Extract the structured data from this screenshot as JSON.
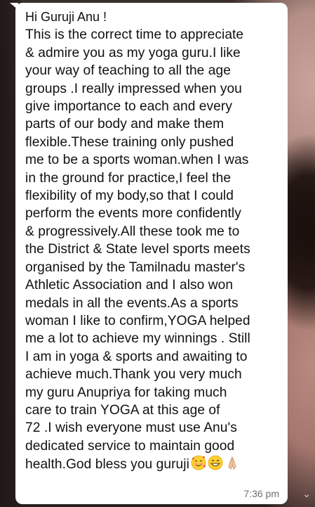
{
  "message": {
    "greeting": "Hi Guruji Anu !",
    "lines": [
      "This is the correct time to appreciate",
      "& admire you as my yoga guru.I like",
      "your way of teaching to all the age",
      "groups .I really impressed when you",
      "give importance to each and every",
      "parts of our body and make them",
      "flexible.These training only pushed",
      "me to be a sports woman.when I was",
      "in the ground for practice,I feel the",
      "flexibility of my body,so that I could",
      "perform the events more confidently",
      "& progressively.All these took me to",
      "the District & State level sports meets",
      "organised by the Tamilnadu master's",
      "Athletic Association and I also won",
      "medals in all the events.As a sports",
      "woman I like to confirm,YOGA helped",
      "me a lot to achieve my winnings . Still",
      "I am in yoga & sports and awaiting to",
      "achieve much.Thank you very much",
      "my guru Anupriya for taking much",
      "care to train YOGA at this age of",
      "72 .I wish everyone must use Anu's",
      "dedicated service to maintain good"
    ],
    "last_line": "health.God bless you guruji",
    "emojis": [
      "smiling-face-with-hearts-icon",
      "grinning-face-icon",
      "folded-hands-icon"
    ],
    "time": "7:36 pm"
  },
  "overlay": {
    "corner_glyph": "⌄"
  },
  "colors": {
    "bubble": "#ffffff",
    "text": "#111111",
    "time": "#6f6f6f"
  }
}
